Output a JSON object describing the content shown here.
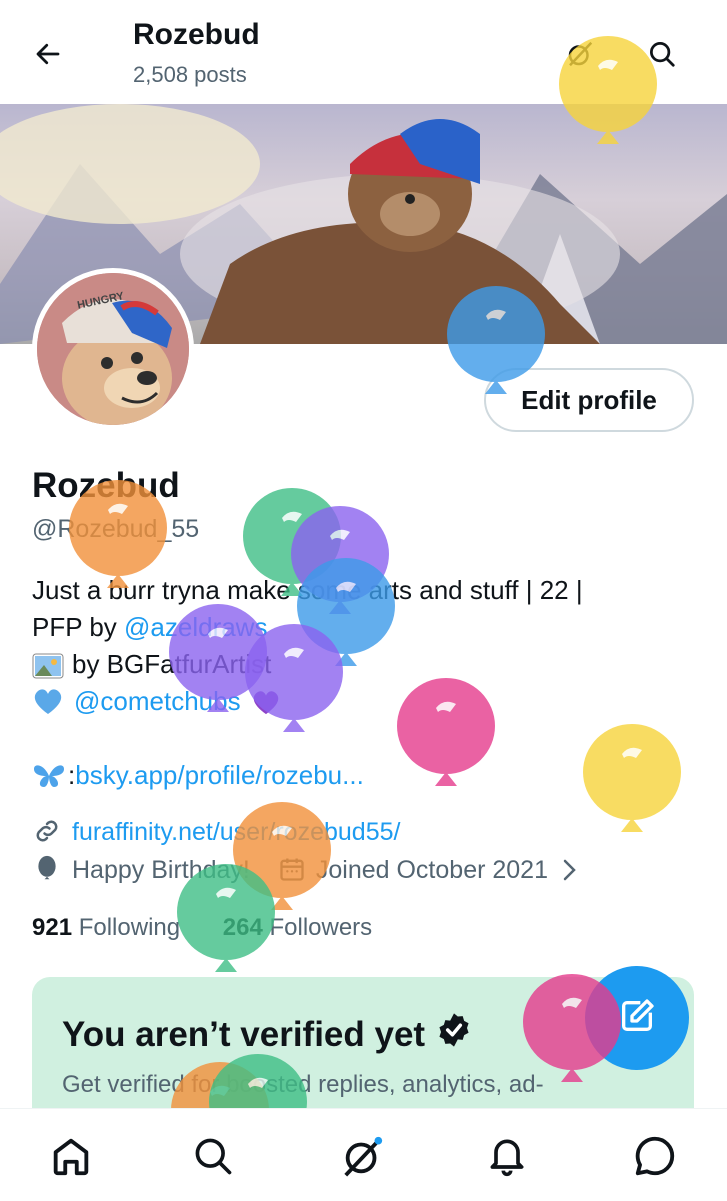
{
  "header": {
    "title": "Rozebud",
    "post_count": "2,508 posts",
    "back_icon": "arrow-left-icon",
    "grok_icon": "grok-icon",
    "search_icon": "search-icon"
  },
  "profile": {
    "name": "Rozebud",
    "handle": "@Rozebud_55",
    "edit_label": "Edit profile",
    "avatar_cap_text": "HUNGRY",
    "bio_line1": "Just a burr tryna make some arts and stuff | 22 |",
    "bio_line2_prefix": "PFP by ",
    "bio_line2_link": "@azeldraws",
    "bio_line3": " by BGFatfurArtist",
    "bio_line4_link": "@cometchubs",
    "bsky_prefix": ": ",
    "bsky_link": "bsky.app/profile/rozebu...",
    "website": "furaffinity.net/user/rozebud55/",
    "birthday": "Happy Birthday!",
    "joined": "Joined October 2021",
    "following_count": "921",
    "following_label": " Following",
    "followers_count": "264",
    "followers_label": " Followers"
  },
  "verify_card": {
    "title": "You aren’t verified yet",
    "text": "Get verified for boosted replies, analytics, ad-"
  },
  "colors": {
    "accent": "#1d9bf0",
    "verify_bg": "#d0f0e0",
    "balloon_yellow": "#f7d43b",
    "balloon_blue": "#3d9be9",
    "balloon_orange": "#f2913a",
    "balloon_green": "#3fbf86",
    "balloon_purple": "#8b63f0",
    "balloon_pink": "#e53c8d"
  },
  "tabs": [
    "home-icon",
    "search-icon",
    "grok-icon",
    "notifications-icon",
    "messages-icon"
  ]
}
